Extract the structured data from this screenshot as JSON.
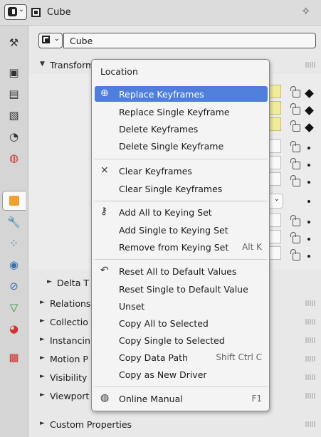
{
  "header": {
    "title": "Cube"
  },
  "object_name": "Cube",
  "tabs": [
    "tool",
    "render",
    "output",
    "view-layer",
    "scene",
    "world",
    "object",
    "modifiers",
    "particles",
    "physics",
    "constraints",
    "data",
    "material",
    "texture"
  ],
  "panels": {
    "transform": "Transform",
    "delta_transform": "Delta T",
    "relations": "Relations",
    "collections": "Collectio",
    "instancing": "Instancin",
    "motion_paths": "Motion P",
    "visibility": "Visibility",
    "viewport_display": "Viewport",
    "custom_properties": "Custom Properties"
  },
  "menu": {
    "title": "Location",
    "items": [
      {
        "label": "Replace Keyframes",
        "icon": "keyframe-add-icon",
        "shortcut": ""
      },
      {
        "label": "Replace Single Keyframe",
        "icon": "",
        "shortcut": ""
      },
      {
        "label": "Delete Keyframes",
        "icon": "",
        "shortcut": ""
      },
      {
        "label": "Delete Single Keyframe",
        "icon": "",
        "shortcut": ""
      },
      {
        "label": "Clear Keyframes",
        "icon": "keyframe-clear-icon",
        "shortcut": ""
      },
      {
        "label": "Clear Single Keyframes",
        "icon": "",
        "shortcut": ""
      },
      {
        "label": "Add All to Keying Set",
        "icon": "keying-set-icon",
        "shortcut": ""
      },
      {
        "label": "Add Single to Keying Set",
        "icon": "",
        "shortcut": ""
      },
      {
        "label": "Remove from Keying Set",
        "icon": "",
        "shortcut": "Alt K"
      },
      {
        "label": "Reset All to Default Values",
        "icon": "reset-icon",
        "shortcut": ""
      },
      {
        "label": "Reset Single to Default Value",
        "icon": "",
        "shortcut": ""
      },
      {
        "label": "Unset",
        "icon": "",
        "shortcut": ""
      },
      {
        "label": "Copy All to Selected",
        "icon": "",
        "shortcut": ""
      },
      {
        "label": "Copy Single to Selected",
        "icon": "",
        "shortcut": ""
      },
      {
        "label": "Copy Data Path",
        "icon": "",
        "shortcut": "Shift Ctrl C"
      },
      {
        "label": "Copy as New Driver",
        "icon": "",
        "shortcut": ""
      },
      {
        "label": "Online Manual",
        "icon": "globe-icon",
        "shortcut": "F1"
      }
    ]
  },
  "colors": {
    "highlight": "#4f7fdb",
    "keyed_field": "#f1ec9c",
    "object_tab": "#f0a030"
  }
}
